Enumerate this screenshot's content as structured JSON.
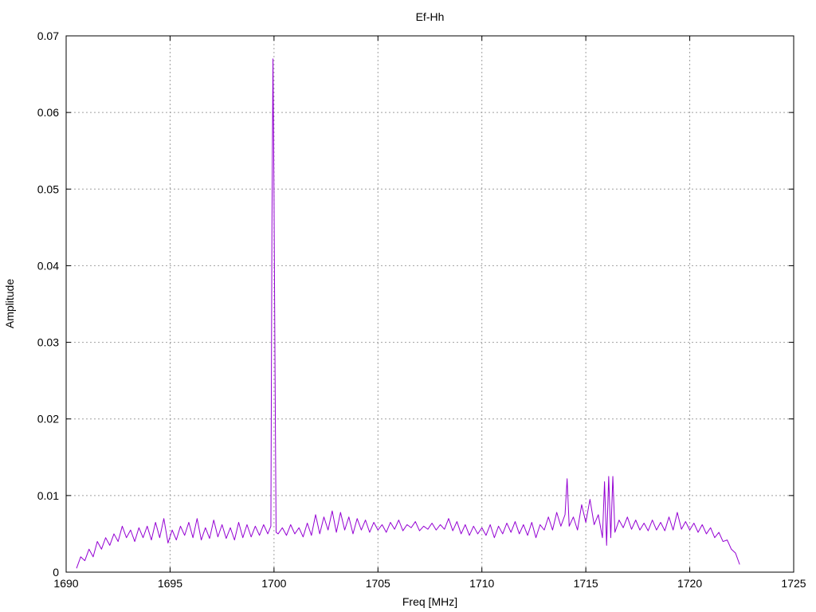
{
  "chart_data": {
    "type": "line",
    "title": "Ef-Hh",
    "xlabel": "Freq [MHz]",
    "ylabel": "Amplitude",
    "xlim": [
      1690,
      1725
    ],
    "ylim": [
      0,
      0.07
    ],
    "xticks": [
      "1690",
      "1695",
      "1700",
      "1705",
      "1710",
      "1715",
      "1720",
      "1725"
    ],
    "yticks": [
      "0",
      "0.01",
      "0.02",
      "0.03",
      "0.04",
      "0.05",
      "0.06",
      "0.07"
    ],
    "grid": true,
    "legend": "none",
    "colors": {
      "series": "#9400d3",
      "grid": "#a0a0a0",
      "axis": "#000000"
    },
    "series": [
      {
        "x": [
          1690.5,
          1690.7,
          1690.9,
          1691.1,
          1691.3,
          1691.5,
          1691.7,
          1691.9,
          1692.1,
          1692.3,
          1692.5,
          1692.7,
          1692.9,
          1693.1,
          1693.3,
          1693.5,
          1693.7,
          1693.9,
          1694.1,
          1694.3,
          1694.5,
          1694.7,
          1694.9,
          1695.1,
          1695.3,
          1695.5,
          1695.7,
          1695.9,
          1696.1,
          1696.3,
          1696.5,
          1696.7,
          1696.9,
          1697.1,
          1697.3,
          1697.5,
          1697.7,
          1697.9,
          1698.1,
          1698.3,
          1698.5,
          1698.7,
          1698.9,
          1699.1,
          1699.3,
          1699.5,
          1699.7,
          1699.85,
          1699.9,
          1699.95,
          1700.0,
          1700.05,
          1700.1,
          1700.2,
          1700.4,
          1700.6,
          1700.8,
          1701.0,
          1701.2,
          1701.4,
          1701.6,
          1701.8,
          1702.0,
          1702.2,
          1702.4,
          1702.6,
          1702.8,
          1703.0,
          1703.2,
          1703.4,
          1703.6,
          1703.8,
          1704.0,
          1704.2,
          1704.4,
          1704.6,
          1704.8,
          1705.0,
          1705.2,
          1705.4,
          1705.6,
          1705.8,
          1706.0,
          1706.2,
          1706.4,
          1706.6,
          1706.8,
          1707.0,
          1707.2,
          1707.4,
          1707.6,
          1707.8,
          1708.0,
          1708.2,
          1708.4,
          1708.6,
          1708.8,
          1709.0,
          1709.2,
          1709.4,
          1709.6,
          1709.8,
          1710.0,
          1710.2,
          1710.4,
          1710.6,
          1710.8,
          1711.0,
          1711.2,
          1711.4,
          1711.6,
          1711.8,
          1712.0,
          1712.2,
          1712.4,
          1712.6,
          1712.8,
          1713.0,
          1713.2,
          1713.4,
          1713.6,
          1713.8,
          1714.0,
          1714.1,
          1714.2,
          1714.4,
          1714.6,
          1714.8,
          1715.0,
          1715.2,
          1715.4,
          1715.6,
          1715.8,
          1715.9,
          1716.0,
          1716.1,
          1716.2,
          1716.3,
          1716.4,
          1716.6,
          1716.8,
          1717.0,
          1717.2,
          1717.4,
          1717.6,
          1717.8,
          1718.0,
          1718.2,
          1718.4,
          1718.6,
          1718.8,
          1719.0,
          1719.2,
          1719.4,
          1719.6,
          1719.8,
          1720.0,
          1720.2,
          1720.4,
          1720.6,
          1720.8,
          1721.0,
          1721.2,
          1721.4,
          1721.6,
          1721.8,
          1722.0,
          1722.2,
          1722.4
        ],
        "y": [
          0.0005,
          0.002,
          0.0015,
          0.003,
          0.002,
          0.004,
          0.003,
          0.0045,
          0.0035,
          0.005,
          0.004,
          0.006,
          0.0045,
          0.0055,
          0.004,
          0.0058,
          0.0045,
          0.006,
          0.0042,
          0.0065,
          0.0045,
          0.007,
          0.0038,
          0.0055,
          0.0042,
          0.006,
          0.0048,
          0.0065,
          0.0045,
          0.007,
          0.0042,
          0.0058,
          0.0044,
          0.0068,
          0.0046,
          0.0062,
          0.0044,
          0.0058,
          0.0042,
          0.0065,
          0.0045,
          0.0062,
          0.0046,
          0.006,
          0.0048,
          0.0062,
          0.005,
          0.006,
          0.045,
          0.067,
          0.049,
          0.026,
          0.0052,
          0.005,
          0.0058,
          0.0048,
          0.0062,
          0.005,
          0.0058,
          0.0046,
          0.0064,
          0.0048,
          0.0075,
          0.005,
          0.0072,
          0.0055,
          0.008,
          0.0052,
          0.0078,
          0.0055,
          0.0072,
          0.005,
          0.007,
          0.0055,
          0.0068,
          0.0052,
          0.0065,
          0.0055,
          0.0062,
          0.0052,
          0.0065,
          0.0056,
          0.0068,
          0.0054,
          0.0062,
          0.0058,
          0.0066,
          0.0054,
          0.006,
          0.0056,
          0.0064,
          0.0055,
          0.0062,
          0.0056,
          0.007,
          0.0054,
          0.0066,
          0.005,
          0.0062,
          0.0048,
          0.006,
          0.005,
          0.0058,
          0.0048,
          0.0062,
          0.0045,
          0.006,
          0.005,
          0.0064,
          0.0052,
          0.0066,
          0.005,
          0.0062,
          0.0048,
          0.0065,
          0.0045,
          0.0062,
          0.0055,
          0.0072,
          0.0055,
          0.0078,
          0.006,
          0.0075,
          0.0122,
          0.006,
          0.0072,
          0.0055,
          0.0088,
          0.0065,
          0.0095,
          0.0062,
          0.0075,
          0.0045,
          0.0118,
          0.0035,
          0.0125,
          0.0045,
          0.0125,
          0.0052,
          0.0068,
          0.0058,
          0.0072,
          0.0056,
          0.0068,
          0.0055,
          0.0064,
          0.0054,
          0.0068,
          0.0055,
          0.0065,
          0.0054,
          0.0072,
          0.0055,
          0.0078,
          0.0056,
          0.0066,
          0.0055,
          0.0064,
          0.0052,
          0.0062,
          0.005,
          0.0058,
          0.0045,
          0.0052,
          0.004,
          0.0042,
          0.003,
          0.0025,
          0.001
        ]
      }
    ]
  }
}
